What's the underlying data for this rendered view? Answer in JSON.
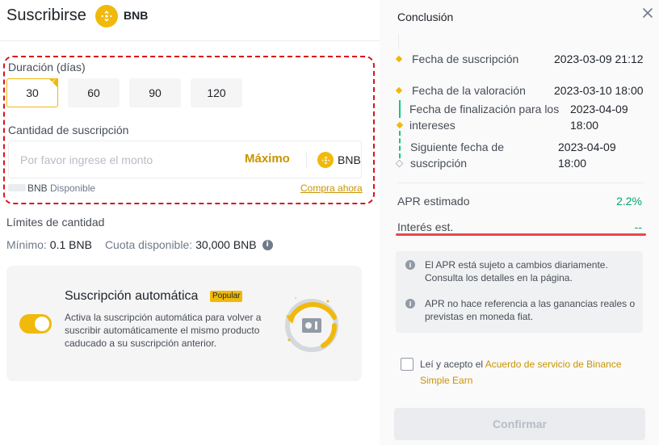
{
  "header": {
    "title": "Suscribirse",
    "coin": "BNB"
  },
  "duration": {
    "label": "Duración (días)",
    "options": [
      "30",
      "60",
      "90",
      "120"
    ],
    "selected": "30"
  },
  "amount": {
    "label": "Cantidad de suscripción",
    "placeholder": "Por favor ingrese el monto",
    "value": "",
    "max_label": "Máximo",
    "coin": "BNB",
    "available_coin": "BNB",
    "available_label": "Disponible",
    "buy_link": "Compra ahora"
  },
  "limits": {
    "title": "Límites de cantidad",
    "min_label": "Mínimo:",
    "min_value": "0.1 BNB",
    "quota_label": "Cuota disponible:",
    "quota_value": "30,000 BNB"
  },
  "auto_subscribe": {
    "title": "Suscripción automática",
    "badge": "Popular",
    "description": "Activa la suscripción automática para volver a suscribir automáticamente el mismo producto caducado a su suscripción anterior.",
    "enabled": true
  },
  "summary": {
    "title": "Conclusión",
    "timeline": [
      {
        "label": "Fecha de suscripción",
        "value": "2023-03-09 21:12"
      },
      {
        "label": "Fecha de la valoración",
        "value": "2023-03-10 18:00"
      },
      {
        "label": "Fecha de finalización para los intereses",
        "value": "2023-04-09 18:00"
      },
      {
        "label": "Siguiente fecha de suscripción",
        "value": "2023-04-09 18:00"
      }
    ],
    "apr_label": "APR estimado",
    "apr_value": "2.2%",
    "interest_label": "Interés est.",
    "interest_value": "--",
    "notes": [
      "El APR está sujeto a cambios diariamente. Consulta los detalles en la página.",
      "APR no hace referencia a las ganancias reales o previstas en moneda fiat."
    ],
    "agree_prefix": "Leí y acepto el ",
    "agree_link": "Acuerdo de servicio de Binance Simple Earn",
    "confirm_label": "Confirmar"
  },
  "colors": {
    "brand": "#f0b90b",
    "link": "#c99400",
    "positive": "#03a66d",
    "highlight_red": "#d9141b"
  }
}
